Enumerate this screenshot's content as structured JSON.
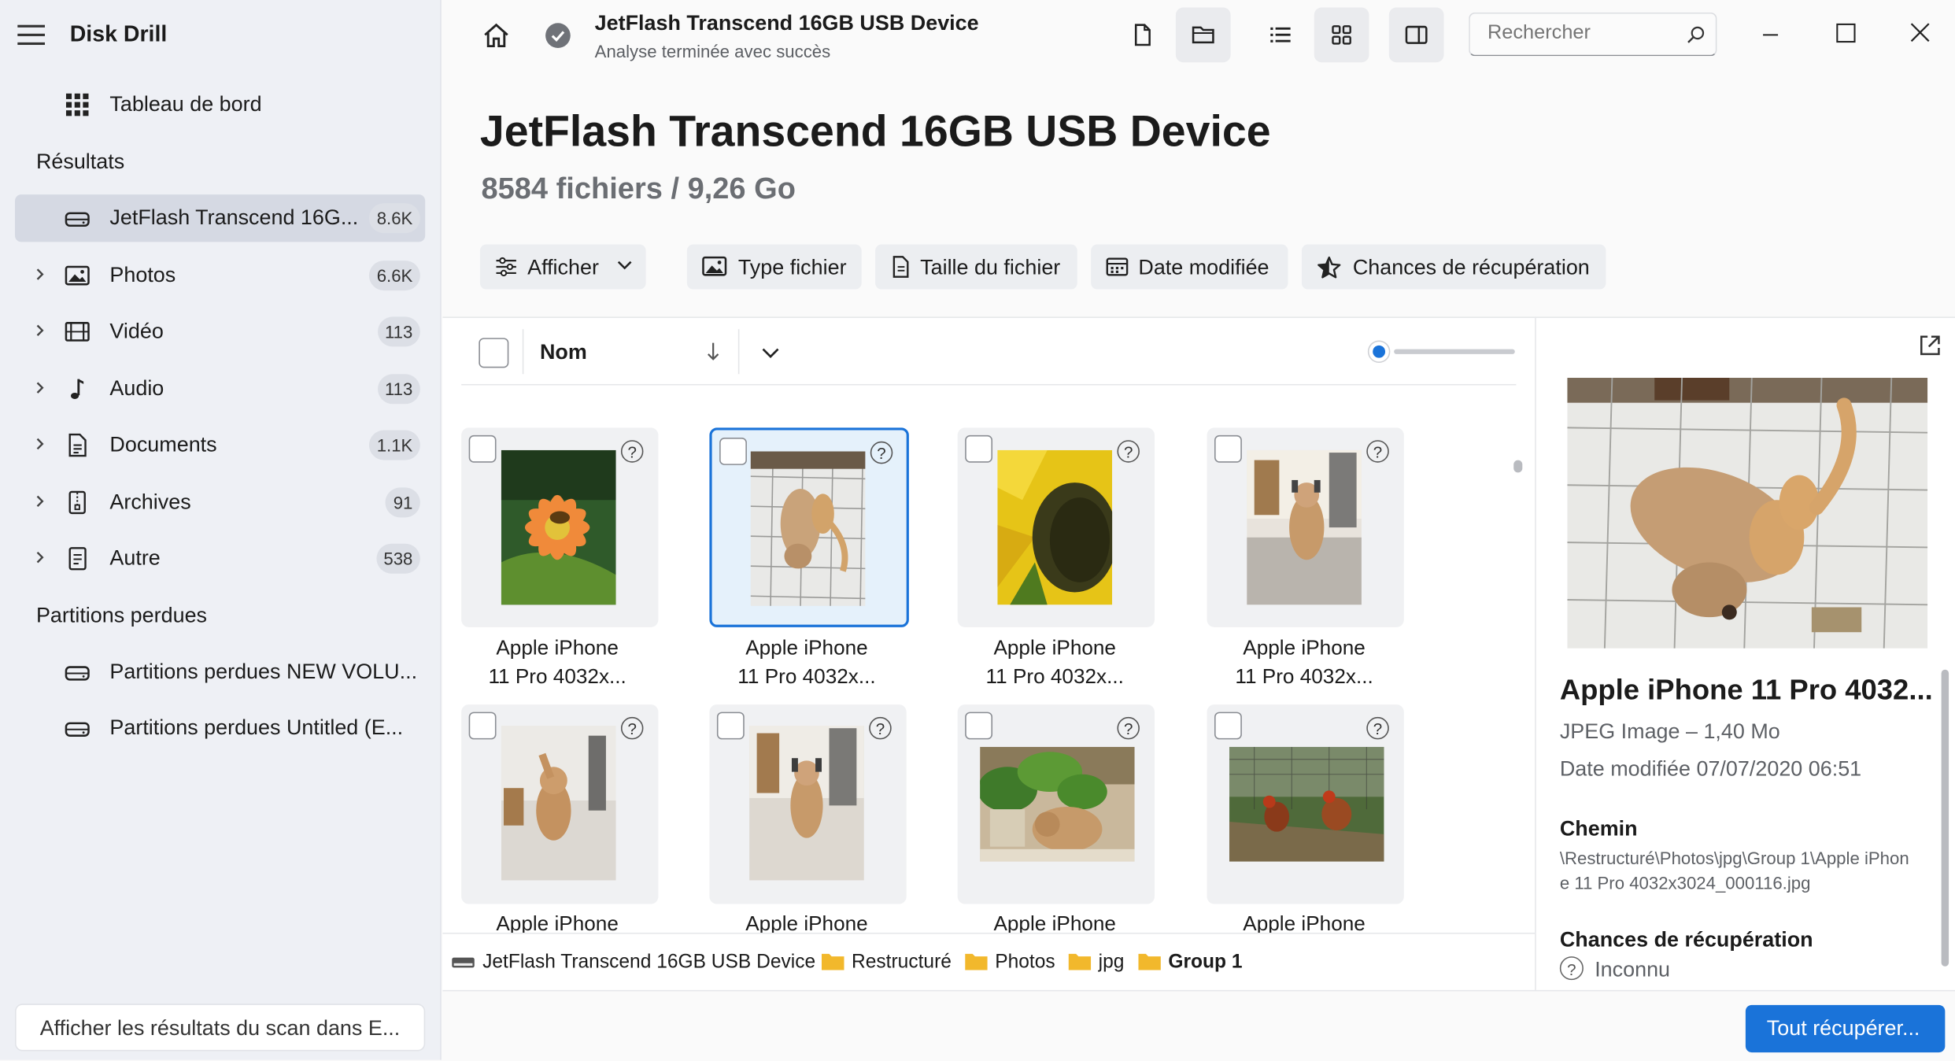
{
  "app": {
    "title": "Disk Drill"
  },
  "sidebar": {
    "dashboard_label": "Tableau de bord",
    "results_heading": "Résultats",
    "device": {
      "label": "JetFlash Transcend 16G...",
      "count": "8.6K"
    },
    "categories": [
      {
        "label": "Photos",
        "count": "6.6K",
        "icon": "image-icon"
      },
      {
        "label": "Vidéo",
        "count": "113",
        "icon": "film-icon"
      },
      {
        "label": "Audio",
        "count": "113",
        "icon": "music-note-icon"
      },
      {
        "label": "Documents",
        "count": "1.1K",
        "icon": "document-icon"
      },
      {
        "label": "Archives",
        "count": "91",
        "icon": "archive-icon"
      },
      {
        "label": "Autre",
        "count": "538",
        "icon": "file-icon"
      }
    ],
    "lost_partitions_heading": "Partitions perdues",
    "lost_partitions": [
      {
        "label": "Partitions perdues NEW VOLU..."
      },
      {
        "label": "Partitions perdues Untitled (E..."
      }
    ],
    "explorer_button": "Afficher les résultats du scan dans E..."
  },
  "topbar": {
    "device_title": "JetFlash Transcend 16GB USB Device",
    "status": "Analyse terminée avec succès",
    "search_placeholder": "Rechercher"
  },
  "main": {
    "title": "JetFlash Transcend 16GB USB Device",
    "subtitle": "8584 fichiers / 9,26 Go",
    "filters": {
      "show": "Afficher",
      "file_type": "Type fichier",
      "file_size": "Taille du fichier",
      "date_modified": "Date modifiée",
      "recovery_chances": "Chances de récupération"
    },
    "column_name": "Nom",
    "files": [
      {
        "line1": "Apple iPhone",
        "line2": "11 Pro 4032x..."
      },
      {
        "line1": "Apple iPhone",
        "line2": "11 Pro 4032x..."
      },
      {
        "line1": "Apple iPhone",
        "line2": "11 Pro 4032x..."
      },
      {
        "line1": "Apple iPhone",
        "line2": "11 Pro 4032x..."
      },
      {
        "line1": "Apple iPhone",
        "line2": ""
      },
      {
        "line1": "Apple iPhone",
        "line2": ""
      },
      {
        "line1": "Apple iPhone",
        "line2": ""
      },
      {
        "line1": "Apple iPhone",
        "line2": ""
      }
    ]
  },
  "breadcrumb": [
    "JetFlash Transcend 16GB USB Device",
    "Restructuré",
    "Photos",
    "jpg",
    "Group 1"
  ],
  "preview": {
    "name": "Apple iPhone 11 Pro 4032...",
    "type_size": "JPEG Image – 1,40 Mo",
    "date": "Date modifiée 07/07/2020 06:51",
    "path_label": "Chemin",
    "path": "\\Restructuré\\Photos\\jpg\\Group 1\\Apple iPhone 11 Pro 4032x3024_000116.jpg",
    "chances_label": "Chances de récupération",
    "chances_value": "Inconnu"
  },
  "recover_button": "Tout récupérer...",
  "colors": {
    "accent": "#1a73d9",
    "sidebar_bg": "#eef0f5"
  }
}
